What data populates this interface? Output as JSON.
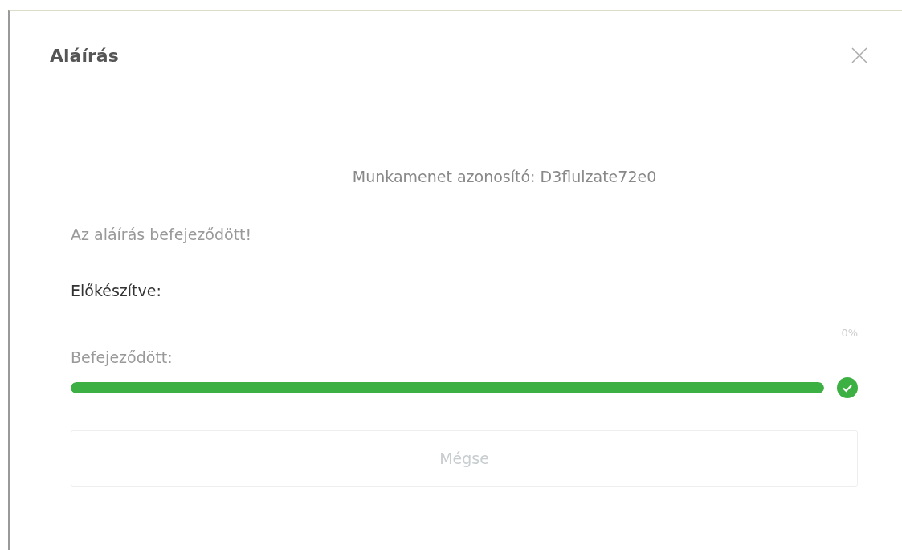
{
  "dialog": {
    "title": "Aláírás",
    "session": "Munkamenet azonosító: D3flulzate72e0",
    "message": "Az aláírás befejeződött!",
    "prepared": {
      "label": "Előkészítve:",
      "reading": "0%"
    },
    "finished": {
      "label": "Befejeződött:",
      "level": 1,
      "done": true
    },
    "cancel": {
      "label": "Mégse",
      "disabled": true
    }
  }
}
